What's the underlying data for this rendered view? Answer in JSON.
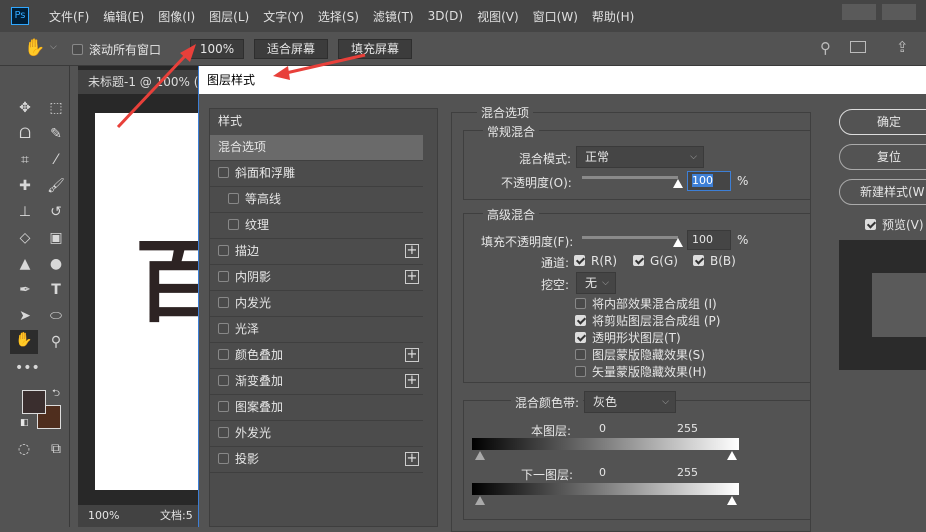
{
  "app": {
    "logo": "Ps",
    "menu": [
      "文件(F)",
      "编辑(E)",
      "图像(I)",
      "图层(L)",
      "文字(Y)",
      "选择(S)",
      "滤镜(T)",
      "3D(D)",
      "视图(V)",
      "窗口(W)",
      "帮助(H)"
    ]
  },
  "options": {
    "scroll_all": "滚动所有窗口",
    "zoom": "100%",
    "fit_screen": "适合屏幕",
    "fill_screen": "填充屏幕"
  },
  "document": {
    "tab": "未标题-1 @ 100% (",
    "canvas_char": "百",
    "zoom": "100%",
    "doc_label": "文档:5"
  },
  "colors": {
    "foreground": "#3a2e2e",
    "background": "#4f2e1e",
    "accent": "#31a8ff",
    "arrow": "#e8403a"
  },
  "dialog": {
    "title": "图层样式",
    "styles_header": "样式",
    "styles": [
      {
        "label": "混合选项",
        "selected": true
      },
      {
        "label": "斜面和浮雕",
        "checkbox": true
      },
      {
        "label": "等高线",
        "checkbox": true,
        "indent": true
      },
      {
        "label": "纹理",
        "checkbox": true,
        "indent": true
      },
      {
        "label": "描边",
        "checkbox": true,
        "plus": true
      },
      {
        "label": "内阴影",
        "checkbox": true,
        "plus": true
      },
      {
        "label": "内发光",
        "checkbox": true
      },
      {
        "label": "光泽",
        "checkbox": true
      },
      {
        "label": "颜色叠加",
        "checkbox": true,
        "plus": true
      },
      {
        "label": "渐变叠加",
        "checkbox": true,
        "plus": true
      },
      {
        "label": "图案叠加",
        "checkbox": true
      },
      {
        "label": "外发光",
        "checkbox": true
      },
      {
        "label": "投影",
        "checkbox": true,
        "plus": true
      }
    ],
    "blend": {
      "section": "混合选项",
      "general": "常规混合",
      "mode_label": "混合模式:",
      "mode": "正常",
      "opacity_label": "不透明度(O):",
      "opacity": "100",
      "pct": "%",
      "advanced": "高级混合",
      "fill_label": "填充不透明度(F):",
      "fill": "100",
      "channels_label": "通道:",
      "ch_r": "R(R)",
      "ch_g": "G(G)",
      "ch_b": "B(B)",
      "knockout_label": "挖空:",
      "knockout": "无",
      "opts": [
        {
          "label": "将内部效果混合成组 (I)",
          "checked": false
        },
        {
          "label": "将剪贴图层混合成组 (P)",
          "checked": true
        },
        {
          "label": "透明形状图层(T)",
          "checked": true
        },
        {
          "label": "图层蒙版隐藏效果(S)",
          "checked": false
        },
        {
          "label": "矢量蒙版隐藏效果(H)",
          "checked": false
        }
      ],
      "band_label": "混合颜色带:",
      "band": "灰色",
      "this_layer": "本图层:",
      "under_layer": "下一图层:",
      "min": "0",
      "max": "255"
    },
    "buttons": {
      "ok": "确定",
      "reset": "复位",
      "new_style": "新建样式(W",
      "preview": "预览(V)"
    }
  }
}
